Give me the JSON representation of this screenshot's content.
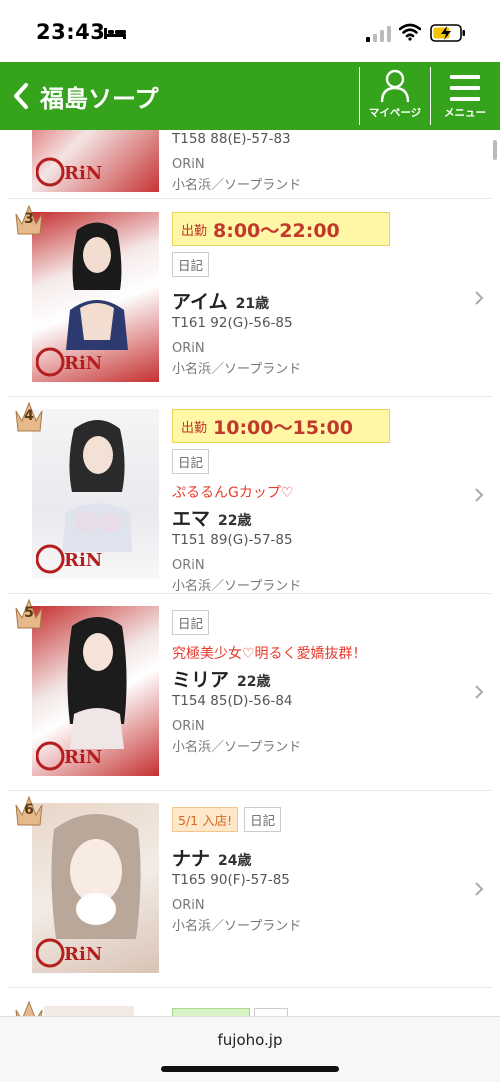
{
  "status_bar": {
    "time": "23:43"
  },
  "header": {
    "title": "福島ソープ",
    "mypage_label": "マイページ",
    "menu_label": "メニュー"
  },
  "items": [
    {
      "rank": "",
      "measurements": "T158 88(E)-57-83",
      "shop": "ORiN",
      "area": "小名浜／ソープランド"
    },
    {
      "rank": "3",
      "schedule_label": "出勤",
      "schedule_time": "8:00〜22:00",
      "tags": [
        "日記"
      ],
      "catch": "",
      "name": "アイム",
      "age": "21歳",
      "measurements": "T161 92(G)-56-85",
      "shop": "ORiN",
      "area": "小名浜／ソープランド"
    },
    {
      "rank": "4",
      "schedule_label": "出勤",
      "schedule_time": "10:00〜15:00",
      "tags": [
        "日記"
      ],
      "catch": "ぷるるんGカップ♡",
      "name": "エマ",
      "age": "22歳",
      "measurements": "T151 89(G)-57-85",
      "shop": "ORiN",
      "area": "小名浜／ソープランド"
    },
    {
      "rank": "5",
      "tags": [
        "日記"
      ],
      "catch": "究極美少女♡明るく愛嬌抜群！",
      "name": "ミリア",
      "age": "22歳",
      "measurements": "T154 85(D)-56-84",
      "shop": "ORiN",
      "area": "小名浜／ソープランド"
    },
    {
      "rank": "6",
      "newcomer": "5/1 入店!",
      "tags": [
        "日記"
      ],
      "name": "ナナ",
      "age": "24歳",
      "measurements": "T165 90(F)-57-85",
      "shop": "ORiN",
      "area": "小名浜／ソープランド"
    }
  ],
  "browser": {
    "url": "fujoho.jp"
  },
  "colors": {
    "brand_green": "#35a31c",
    "schedule_bg": "#fff6a6",
    "catch_red": "#e53b2c"
  }
}
